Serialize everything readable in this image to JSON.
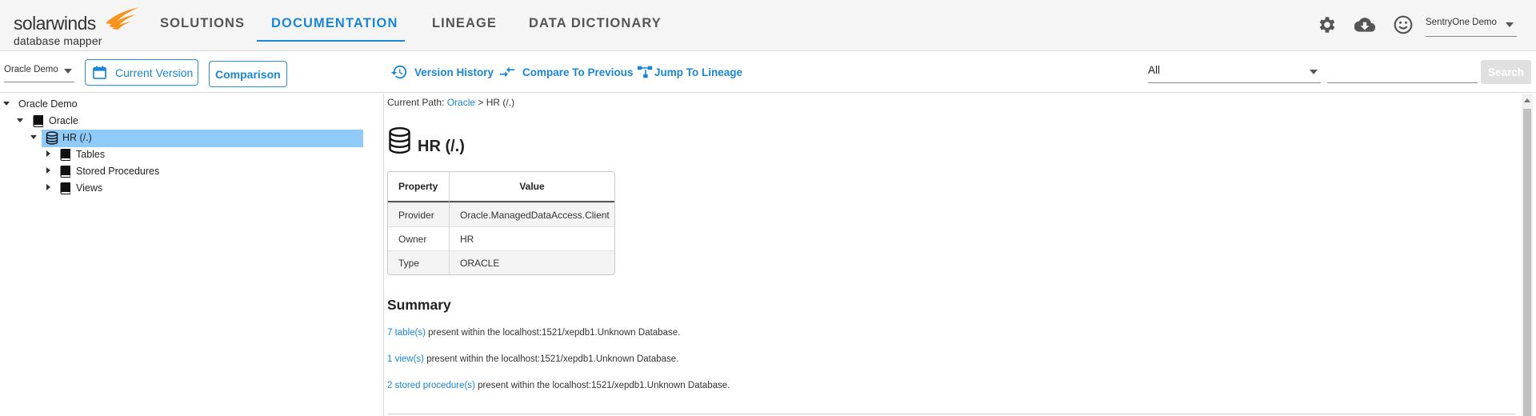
{
  "header": {
    "logo_name": "solarwinds",
    "logo_sub": "database mapper",
    "nav": [
      {
        "label": "SOLUTIONS"
      },
      {
        "label": "DOCUMENTATION"
      },
      {
        "label": "LINEAGE"
      },
      {
        "label": "DATA DICTIONARY"
      }
    ],
    "active_nav": "DOCUMENTATION",
    "icons": [
      "gear-icon",
      "cloud-download-icon",
      "smiley-icon"
    ],
    "user": "SentryOne Demo",
    "accent_color": "#1a87d6",
    "logo_color": "#f7941d"
  },
  "toolbar": {
    "db_select": "Oracle Demo",
    "current_version": "Current Version",
    "comparison": "Comparison",
    "version_history": "Version History",
    "compare_previous": "Compare To Previous",
    "jump_lineage": "Jump To Lineage",
    "filter": "All",
    "search_value": "",
    "search_button": "Search"
  },
  "tree": {
    "root": "Oracle Demo",
    "oracle": "Oracle",
    "hr": "HR (/.)",
    "tables": "Tables",
    "procedures": "Stored Procedures",
    "views": "Views",
    "selected": "HR (/.)",
    "selected_color": "#90caf9"
  },
  "content": {
    "path_prefix": "Current Path:",
    "path_link": "Oracle",
    "path_sep": ">",
    "path_current": "HR (/.)",
    "title": "HR (/.)",
    "table": {
      "headers": [
        "Property",
        "Value"
      ],
      "rows": [
        [
          "Provider",
          "Oracle.ManagedDataAccess.Client"
        ],
        [
          "Owner",
          "HR"
        ],
        [
          "Type",
          "ORACLE"
        ]
      ]
    },
    "summary_heading": "Summary",
    "summary": [
      {
        "link": "7 table(s)",
        "text": " present within the localhost:1521/xepdb1.Unknown Database."
      },
      {
        "link": "1 view(s)",
        "text": " present within the localhost:1521/xepdb1.Unknown Database."
      },
      {
        "link": "2 stored procedure(s)",
        "text": " present within the localhost:1521/xepdb1.Unknown Database."
      }
    ]
  }
}
